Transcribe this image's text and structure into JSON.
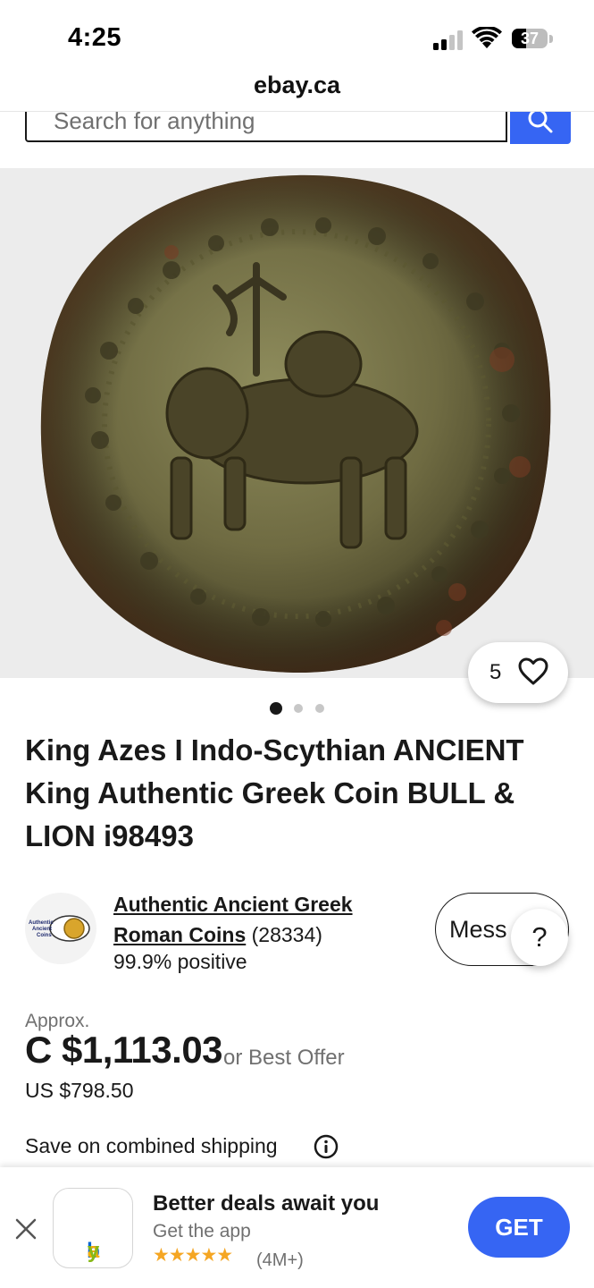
{
  "status_bar": {
    "time": "4:25",
    "battery": "37"
  },
  "browser": {
    "url": "ebay.ca"
  },
  "search": {
    "placeholder": "Search for anything"
  },
  "gallery": {
    "watch_count": "5",
    "image_count": 3,
    "active_index": 0
  },
  "listing": {
    "title": "King Azes I Indo-Scythian ANCIENT King Authentic Greek Coin BULL & LION i98493"
  },
  "seller": {
    "avatar_text": "Authentic Ancient Coins",
    "name": "Authentic Ancient Greek Roman Coins",
    "feedback_count": "(28334)",
    "positive": "99.9% positive",
    "message_label": "Mess",
    "help_label": "?"
  },
  "price": {
    "approx_label": "Approx.",
    "cad": "C $1,113.03",
    "best_offer": "or Best Offer",
    "usd": "US $798.50"
  },
  "shipping": {
    "label": "Save on combined shipping"
  },
  "app_banner": {
    "app_name": "ebay",
    "title": "Better deals await you",
    "subtitle": "Get the app",
    "stars": "★★★★★",
    "rating_count": "(4M+)",
    "get_label": "GET"
  },
  "colors": {
    "accent": "#3665f3",
    "text": "#191919",
    "muted": "#707070"
  }
}
